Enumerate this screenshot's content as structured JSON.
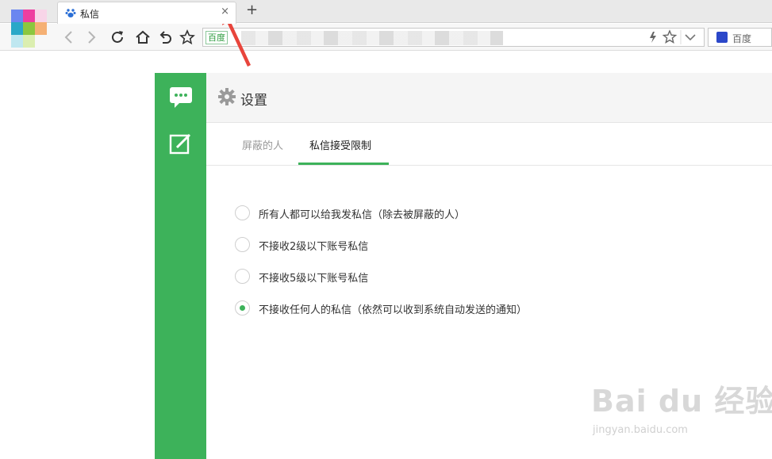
{
  "browser": {
    "tab_title": "私信",
    "tab_close": "×",
    "new_tab": "+",
    "address_prefix": "百度",
    "search_label": "百度"
  },
  "page": {
    "header_title": "设置",
    "tabs": [
      {
        "label": "屏蔽的人",
        "active": false
      },
      {
        "label": "私信接受限制",
        "active": true
      }
    ],
    "options": [
      {
        "label": "所有人都可以给我发私信（除去被屏蔽的人）",
        "checked": false
      },
      {
        "label": "不接收2级以下账号私信",
        "checked": false
      },
      {
        "label": "不接收5级以下账号私信",
        "checked": false
      },
      {
        "label": "不接收任何人的私信（依然可以收到系统自动发送的通知）",
        "checked": true
      }
    ]
  },
  "watermark": {
    "main": "Bai du 经验",
    "sub": "jingyan.baidu.com"
  },
  "colors": {
    "accent": "#3db25a",
    "arrow": "#e8453c",
    "search_brand": "#2b47c9"
  }
}
